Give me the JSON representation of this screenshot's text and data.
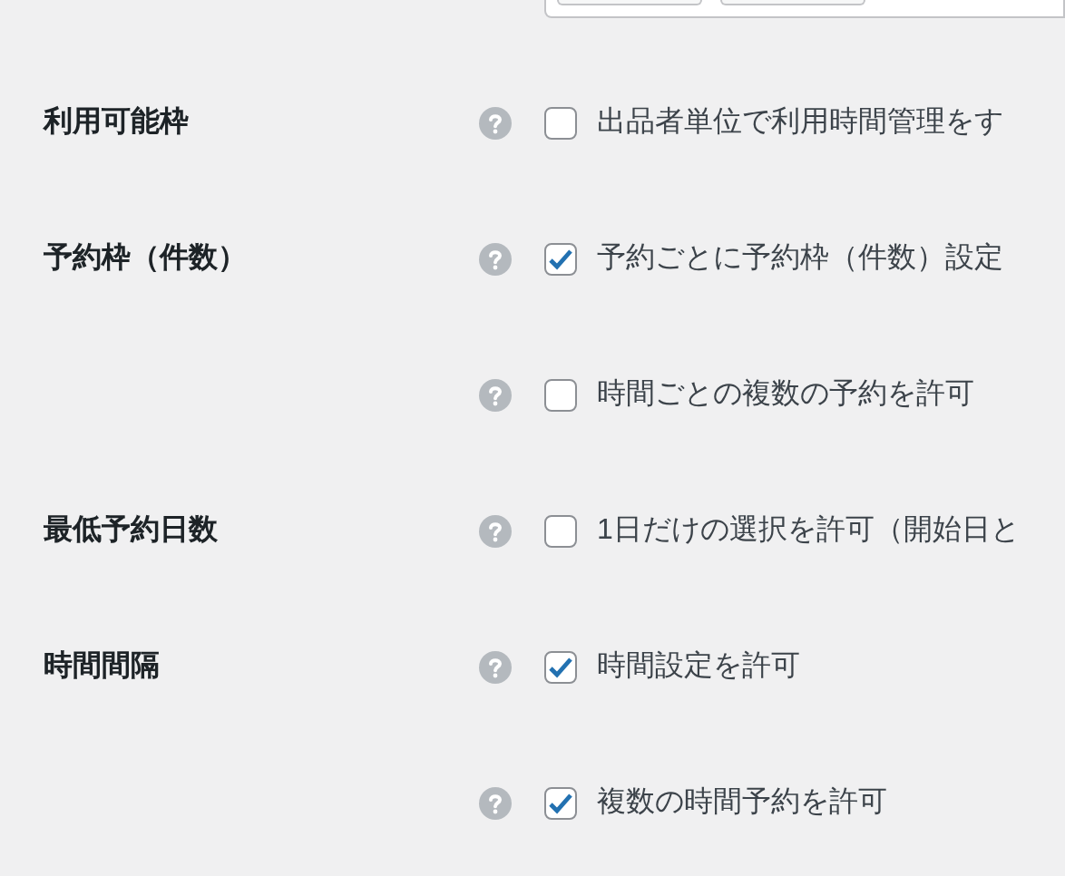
{
  "rows": [
    {
      "label": "利用可能枠",
      "checked": false,
      "text": "出品者単位で利用時間管理をす"
    },
    {
      "label": "予約枠（件数）",
      "checked": true,
      "text": "予約ごとに予約枠（件数）設定"
    },
    {
      "checked": false,
      "text": "時間ごとの複数の予約を許可"
    },
    {
      "label": "最低予約日数",
      "checked": false,
      "text": "1日だけの選択を許可（開始日と"
    },
    {
      "label": "時間間隔",
      "checked": true,
      "text": "時間設定を許可"
    },
    {
      "checked": true,
      "text": "複数の時間予約を許可"
    }
  ]
}
